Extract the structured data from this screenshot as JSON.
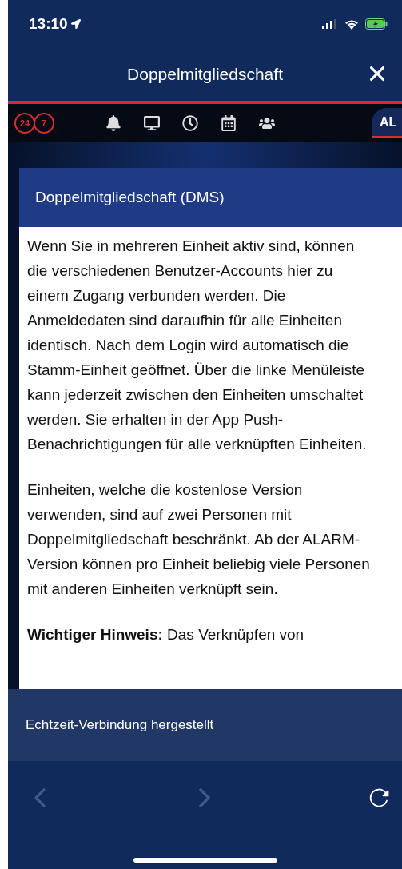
{
  "status_bar": {
    "time": "13:10"
  },
  "header": {
    "title": "Doppelmitgliedschaft"
  },
  "toolbar": {
    "badges": [
      "24",
      "7"
    ],
    "avatar": "AL",
    "avatar_selected": true
  },
  "card": {
    "title": "Doppelmitgliedschaft (DMS)",
    "paragraphs": [
      "Wenn Sie in mehreren Einheit aktiv sind, können die verschiedenen Benutzer-Accounts hier zu einem Zugang verbunden werden. Die Anmeldedaten sind daraufhin für alle Einheiten identisch. Nach dem Login wird automatisch die Stamm-Einheit geöffnet. Über die linke Menüleiste kann jederzeit zwischen den Einheiten umschaltet werden. Sie erhalten in der App Push-Benachrichtigungen für alle verknüpften Einheiten.",
      "Einheiten, welche die kostenlose Version verwenden, sind auf zwei Personen mit Doppelmitgliedschaft beschränkt. Ab der ALARM-Version können pro Einheit beliebig viele Personen mit anderen Einheiten verknüpft sein.",
      "**Wichtiger Hinweis:** Das Verknüpfen von"
    ]
  },
  "toast": {
    "message": "Echtzeit-Verbindung hergestellt"
  },
  "nav": {
    "back_disabled": true,
    "forward_disabled": true
  }
}
